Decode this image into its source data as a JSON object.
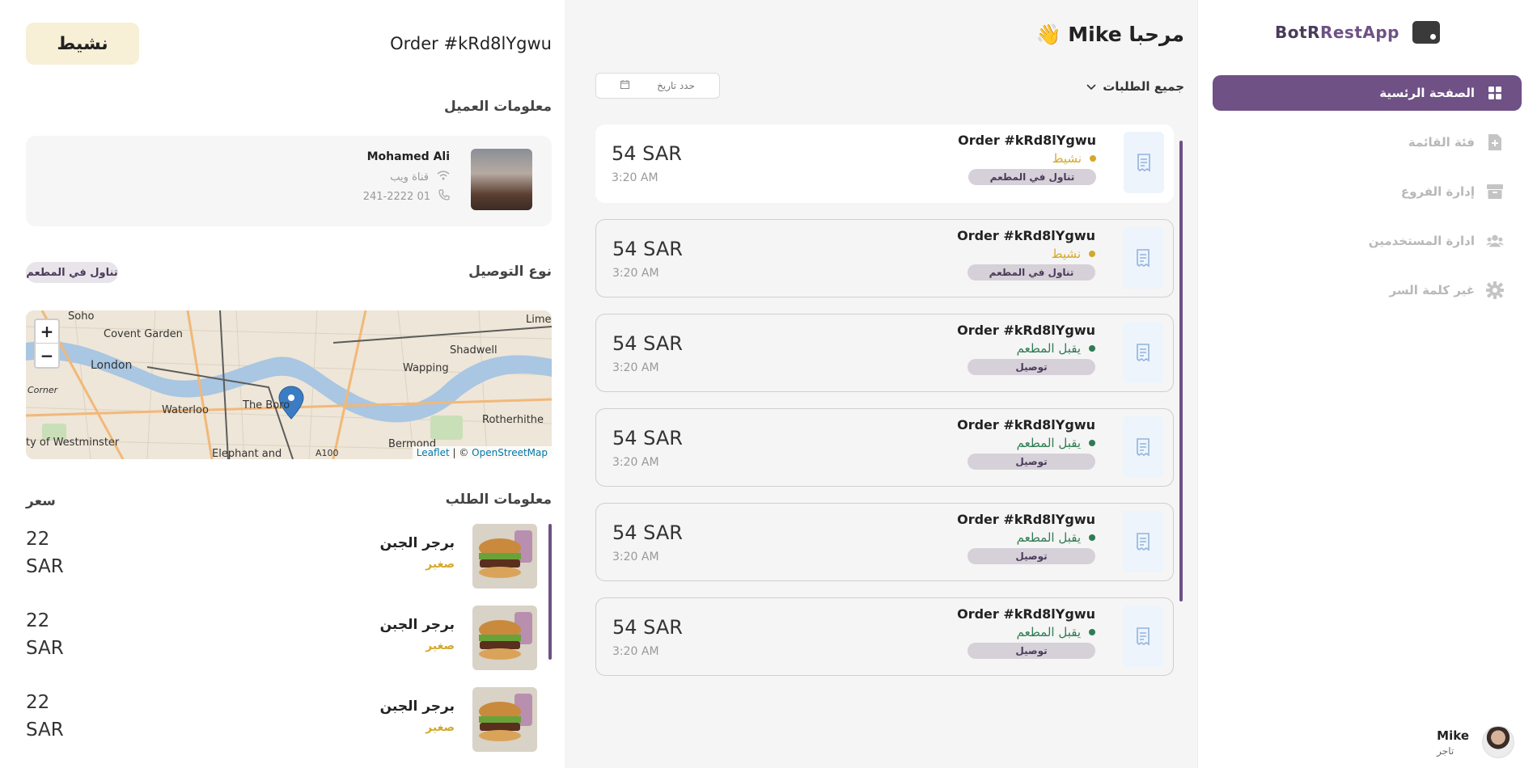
{
  "app": {
    "brand_prefix": "BotR",
    "brand_suffix": "RestApp"
  },
  "sidebar": {
    "items": [
      {
        "label": "الصفحة الرئسية",
        "icon": "grid-icon"
      },
      {
        "label": "فئة القائمة",
        "icon": "add-file-icon"
      },
      {
        "label": "إدارة الفروع",
        "icon": "archive-box-icon"
      },
      {
        "label": "ادارة المستخدمين",
        "icon": "users-icon"
      },
      {
        "label": "غير كلمة السر",
        "icon": "gear-icon"
      }
    ],
    "user": {
      "name": "Mike",
      "role": "تاجر"
    }
  },
  "orders_panel": {
    "welcome": "مرحبا Mike",
    "wave": "👋",
    "filter_label": "جميع الطلبات",
    "date_placeholder": "حدد تاريخ",
    "orders": [
      {
        "title": "Order #kRd8lYgwu",
        "status": "نشيط",
        "status_type": "active",
        "tag": "تناول في المطعم",
        "price": "54 SAR",
        "time": "3:20 AM",
        "selected": true
      },
      {
        "title": "Order #kRd8lYgwu",
        "status": "نشيط",
        "status_type": "active",
        "tag": "تناول في المطعم",
        "price": "54 SAR",
        "time": "3:20 AM",
        "selected": false
      },
      {
        "title": "Order #kRd8lYgwu",
        "status": "يقبل المطعم",
        "status_type": "accepted",
        "tag": "توصيل",
        "price": "54 SAR",
        "time": "3:20 AM",
        "selected": false
      },
      {
        "title": "Order #kRd8lYgwu",
        "status": "يقبل المطعم",
        "status_type": "accepted",
        "tag": "توصيل",
        "price": "54 SAR",
        "time": "3:20 AM",
        "selected": false
      },
      {
        "title": "Order #kRd8lYgwu",
        "status": "يقبل المطعم",
        "status_type": "accepted",
        "tag": "توصيل",
        "price": "54 SAR",
        "time": "3:20 AM",
        "selected": false
      },
      {
        "title": "Order #kRd8lYgwu",
        "status": "يقبل المطعم",
        "status_type": "accepted",
        "tag": "توصيل",
        "price": "54 SAR",
        "time": "3:20 AM",
        "selected": false
      }
    ]
  },
  "detail": {
    "status_pill": "نشيط",
    "title": "Order #kRd8lYgwu",
    "customer_heading": "معلومات العميل",
    "customer": {
      "name": "Mohamed Ali",
      "channel": "قناة ويب",
      "phone": "01 241-2222"
    },
    "delivery_heading": "نوع التوصيل",
    "delivery_type": "تناول في المطعم",
    "map": {
      "zoom_in": "+",
      "zoom_out": "−",
      "attribution_leaflet": "Leaflet",
      "attribution_sep": " | © ",
      "attribution_osm": "OpenStreetMap",
      "labels": [
        "Soho",
        "Covent Garden",
        "London",
        "Limeh",
        "Shadwell",
        "Wapping",
        "Waterloo",
        "The Boro",
        "Rotherhithe",
        "ty of Westminster",
        "Elephant and",
        "A100",
        "Bermond",
        "Corner"
      ]
    },
    "order_heading": "معلومات الطلب",
    "price_heading": "سعر",
    "items": [
      {
        "name": "برجر الجبن",
        "size": "صغير",
        "price_value": "22",
        "price_currency": "SAR"
      },
      {
        "name": "برجر الجبن",
        "size": "صغير",
        "price_value": "22",
        "price_currency": "SAR"
      },
      {
        "name": "برجر الجبن",
        "size": "صغير",
        "price_value": "22",
        "price_currency": "SAR"
      }
    ]
  },
  "colors": {
    "accent": "#6f5185",
    "status_active": "#d4a82c",
    "status_accepted": "#2f7c53"
  }
}
